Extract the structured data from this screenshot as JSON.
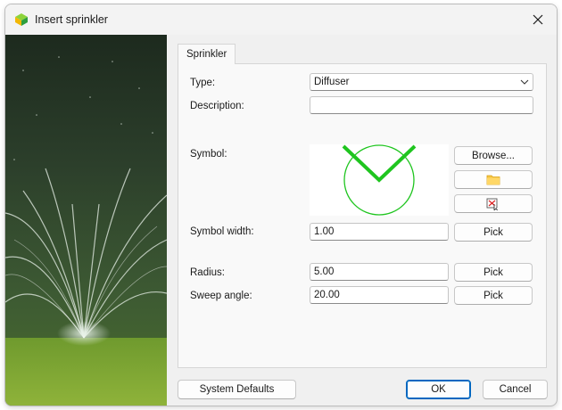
{
  "window": {
    "title": "Insert sprinkler"
  },
  "tabs": [
    {
      "label": "Sprinkler"
    }
  ],
  "form": {
    "type_label": "Type:",
    "type_value": "Diffuser",
    "description_label": "Description:",
    "description_value": "",
    "symbol_label": "Symbol:",
    "symbol_width_label": "Symbol width:",
    "symbol_width_value": "1.00",
    "radius_label": "Radius:",
    "radius_value": "5.00",
    "sweep_label": "Sweep angle:",
    "sweep_value": "20.00"
  },
  "buttons": {
    "browse": "Browse...",
    "pick": "Pick",
    "system_defaults": "System Defaults",
    "ok": "OK",
    "cancel": "Cancel"
  },
  "colors": {
    "symbol_green": "#1fc51f",
    "accent": "#0067c0"
  }
}
